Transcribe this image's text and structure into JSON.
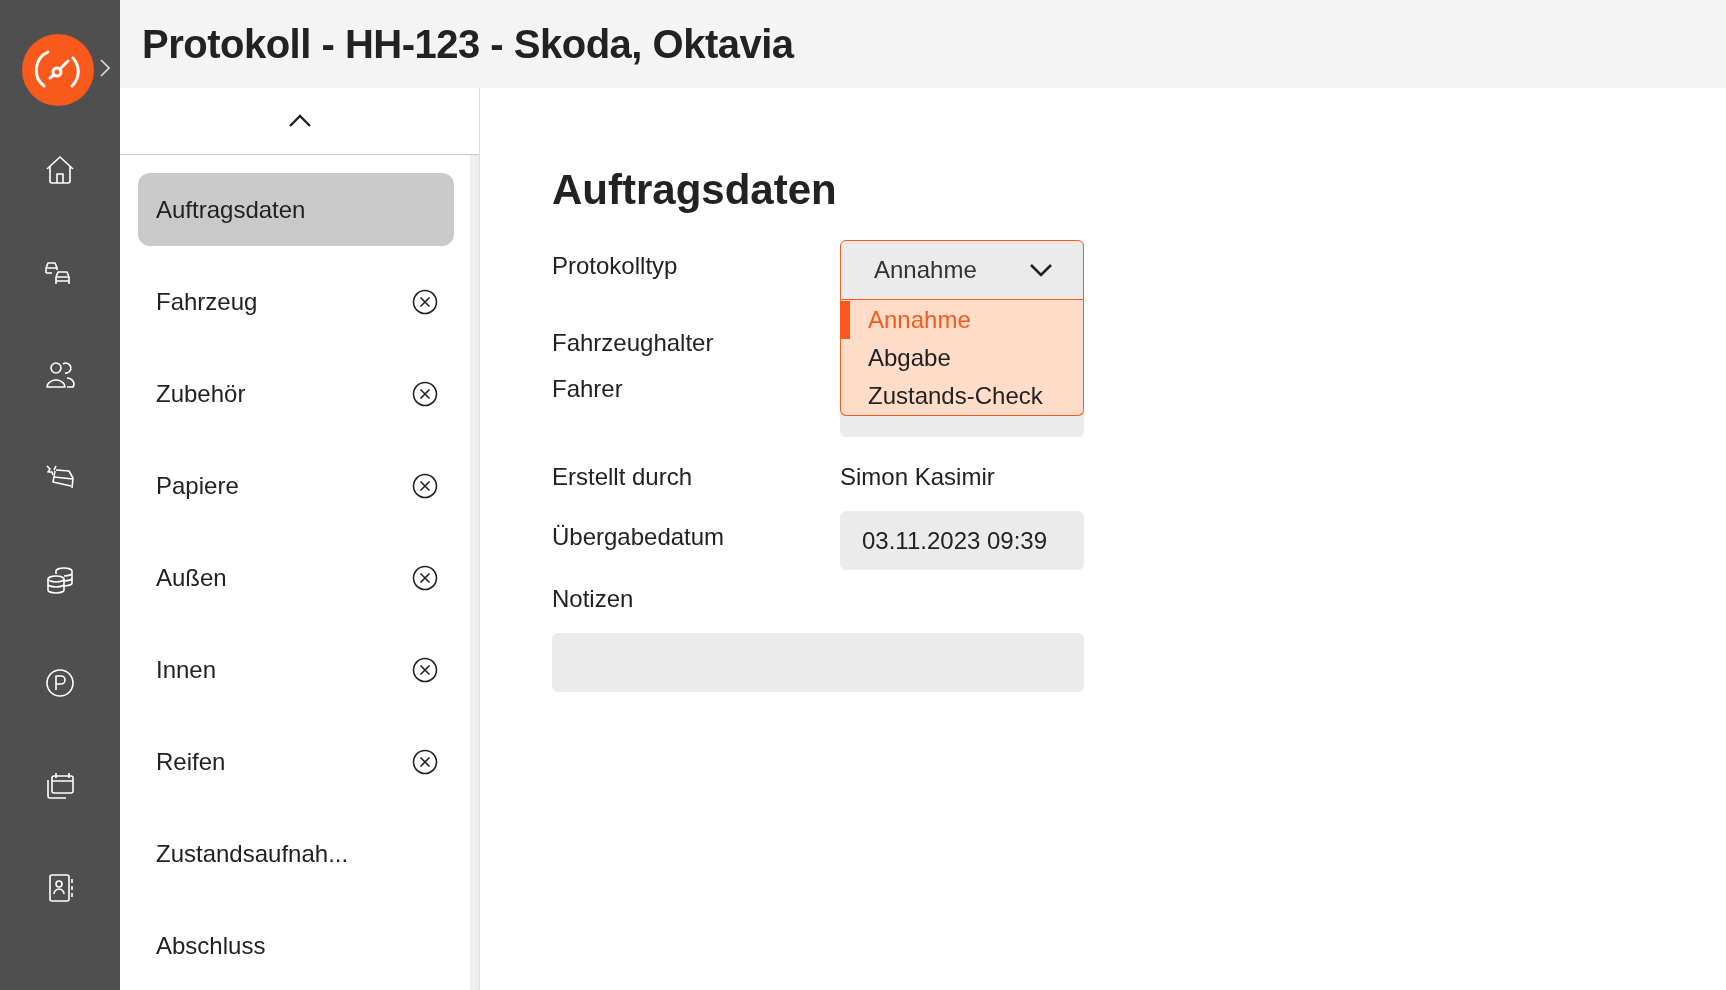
{
  "header": {
    "title": "Protokoll - HH-123 - Skoda, Oktavia"
  },
  "nav": {
    "items": [
      {
        "label": "Auftragsdaten",
        "selected": true,
        "incomplete": false
      },
      {
        "label": "Fahrzeug",
        "selected": false,
        "incomplete": true
      },
      {
        "label": "Zubehör",
        "selected": false,
        "incomplete": true
      },
      {
        "label": "Papiere",
        "selected": false,
        "incomplete": true
      },
      {
        "label": "Außen",
        "selected": false,
        "incomplete": true
      },
      {
        "label": "Innen",
        "selected": false,
        "incomplete": true
      },
      {
        "label": "Reifen",
        "selected": false,
        "incomplete": true
      },
      {
        "label": "Zustandsaufnah...",
        "selected": false,
        "incomplete": false
      },
      {
        "label": "Abschluss",
        "selected": false,
        "incomplete": false
      }
    ]
  },
  "form": {
    "heading": "Auftragsdaten",
    "protokolltyp": {
      "label": "Protokolltyp",
      "value": "Annahme",
      "expanded": true,
      "options": [
        {
          "label": "Annahme",
          "selected": true
        },
        {
          "label": "Abgabe",
          "selected": false
        },
        {
          "label": "Zustands-Check",
          "selected": false
        }
      ]
    },
    "fahrzeughalter": {
      "label": "Fahrzeughalter"
    },
    "fahrer": {
      "label": "Fahrer"
    },
    "erstellt_durch": {
      "label": "Erstellt durch",
      "value": "Simon Kasimir"
    },
    "uebergabedatum": {
      "label": "Übergabedatum",
      "value": "03.11.2023 09:39"
    },
    "notizen": {
      "label": "Notizen"
    }
  }
}
